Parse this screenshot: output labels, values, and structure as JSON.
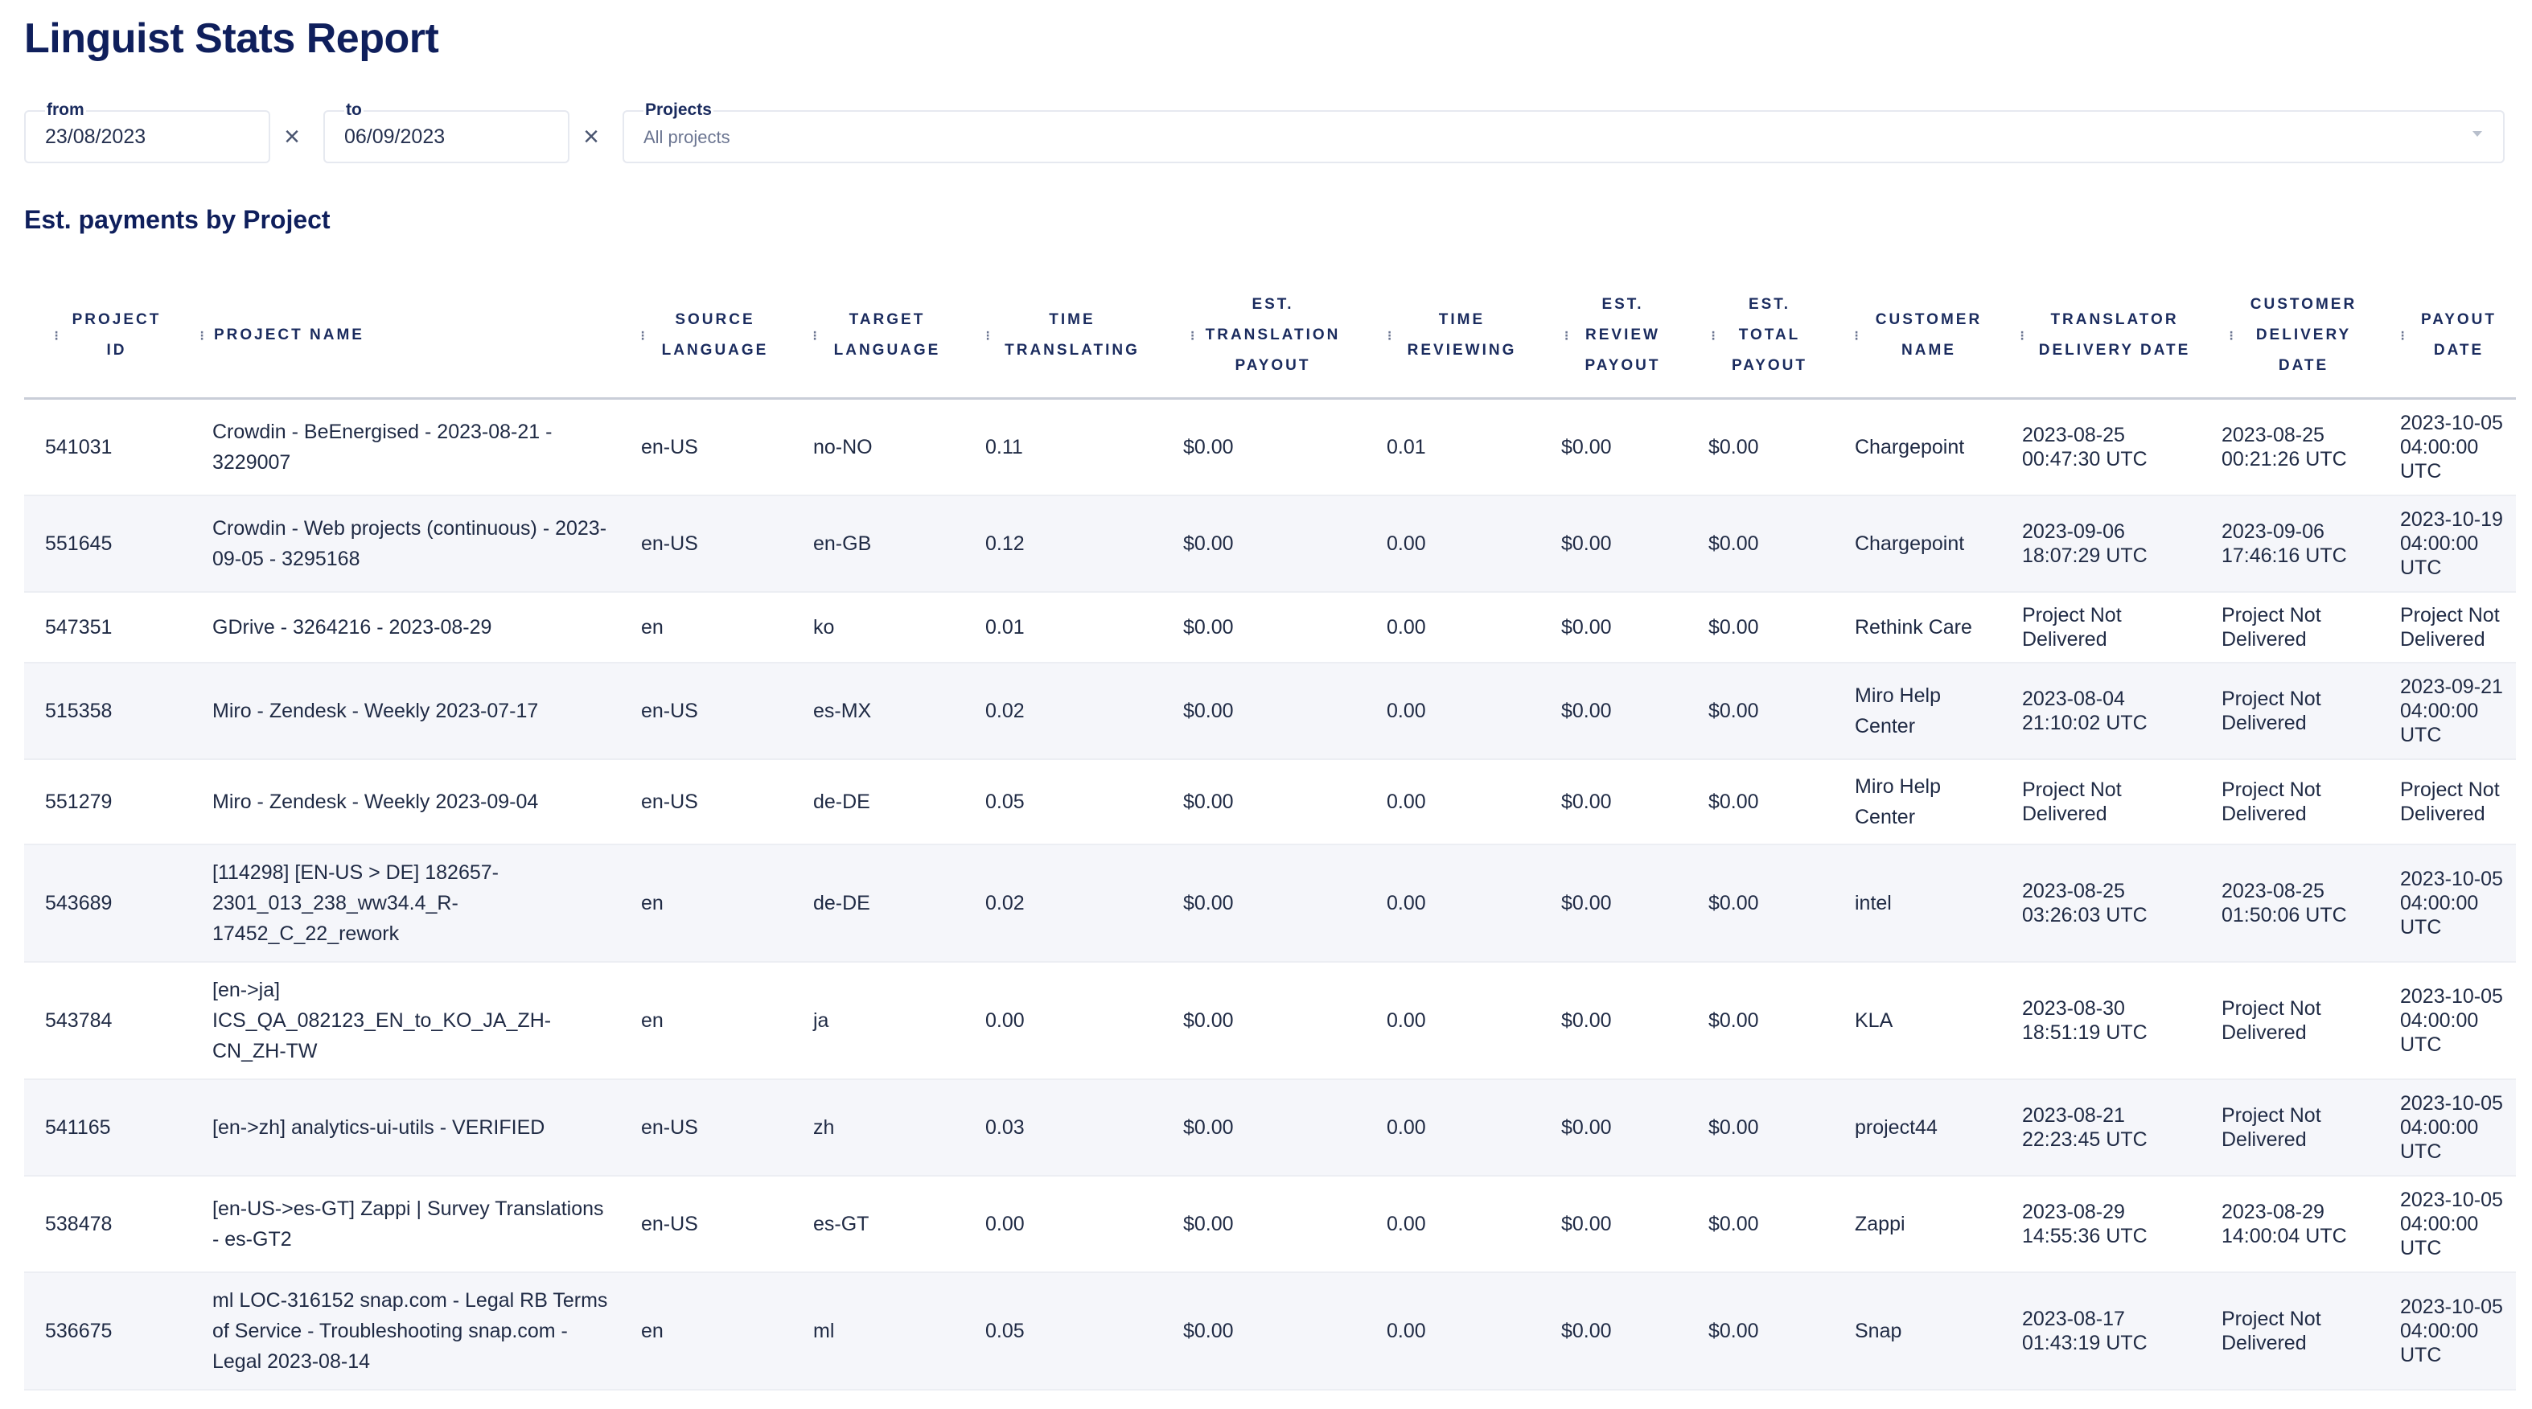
{
  "page": {
    "title": "Linguist Stats Report"
  },
  "filters": {
    "from": {
      "label": "from",
      "value": "23/08/2023"
    },
    "to": {
      "label": "to",
      "value": "06/09/2023"
    },
    "projects": {
      "label": "Projects",
      "placeholder": "All projects"
    }
  },
  "section": {
    "title": "Est. payments by Project"
  },
  "table": {
    "headers": [
      "Project ID",
      "Project Name",
      "Source Language",
      "Target Language",
      "Time Translating",
      "Est. Translation Payout",
      "Time Reviewing",
      "Est. Review Payout",
      "Est. Total Payout",
      "Customer Name",
      "Translator Delivery Date",
      "Customer Delivery Date",
      "Payout Date"
    ],
    "rows": [
      [
        "541031",
        "Crowdin - BeEnergised - 2023-08-21 - 3229007",
        "en-US",
        "no-NO",
        "0.11",
        "$0.00",
        "0.01",
        "$0.00",
        "$0.00",
        "Chargepoint",
        "2023-08-25 00:47:30 UTC",
        "2023-08-25 00:21:26 UTC",
        "2023-10-05 04:00:00 UTC"
      ],
      [
        "551645",
        "Crowdin - Web projects (continuous) - 2023-09-05 - 3295168",
        "en-US",
        "en-GB",
        "0.12",
        "$0.00",
        "0.00",
        "$0.00",
        "$0.00",
        "Chargepoint",
        "2023-09-06 18:07:29 UTC",
        "2023-09-06 17:46:16 UTC",
        "2023-10-19 04:00:00 UTC"
      ],
      [
        "547351",
        "GDrive - 3264216 - 2023-08-29",
        "en",
        "ko",
        "0.01",
        "$0.00",
        "0.00",
        "$0.00",
        "$0.00",
        "Rethink Care",
        "Project Not Delivered",
        "Project Not Delivered",
        "Project Not Delivered"
      ],
      [
        "515358",
        "Miro - Zendesk - Weekly 2023-07-17",
        "en-US",
        "es-MX",
        "0.02",
        "$0.00",
        "0.00",
        "$0.00",
        "$0.00",
        "Miro Help Center",
        "2023-08-04 21:10:02 UTC",
        "Project Not Delivered",
        "2023-09-21 04:00:00 UTC"
      ],
      [
        "551279",
        "Miro - Zendesk - Weekly 2023-09-04",
        "en-US",
        "de-DE",
        "0.05",
        "$0.00",
        "0.00",
        "$0.00",
        "$0.00",
        "Miro Help Center",
        "Project Not Delivered",
        "Project Not Delivered",
        "Project Not Delivered"
      ],
      [
        "543689",
        "[114298] [EN-US > DE] 182657-2301_013_238_ww34.4_R-17452_C_22_rework",
        "en",
        "de-DE",
        "0.02",
        "$0.00",
        "0.00",
        "$0.00",
        "$0.00",
        "intel",
        "2023-08-25 03:26:03 UTC",
        "2023-08-25 01:50:06 UTC",
        "2023-10-05 04:00:00 UTC"
      ],
      [
        "543784",
        "[en->ja] ICS_QA_082123_EN_to_KO_JA_ZH-CN_ZH-TW",
        "en",
        "ja",
        "0.00",
        "$0.00",
        "0.00",
        "$0.00",
        "$0.00",
        "KLA",
        "2023-08-30 18:51:19 UTC",
        "Project Not Delivered",
        "2023-10-05 04:00:00 UTC"
      ],
      [
        "541165",
        "[en->zh] analytics-ui-utils - VERIFIED",
        "en-US",
        "zh",
        "0.03",
        "$0.00",
        "0.00",
        "$0.00",
        "$0.00",
        "project44",
        "2023-08-21 22:23:45 UTC",
        "Project Not Delivered",
        "2023-10-05 04:00:00 UTC"
      ],
      [
        "538478",
        "[en-US->es-GT] Zappi | Survey Translations - es-GT2",
        "en-US",
        "es-GT",
        "0.00",
        "$0.00",
        "0.00",
        "$0.00",
        "$0.00",
        "Zappi",
        "2023-08-29 14:55:36 UTC",
        "2023-08-29 14:00:04 UTC",
        "2023-10-05 04:00:00 UTC"
      ],
      [
        "536675",
        "ml LOC-316152 snap.com - Legal RB Terms of Service - Troubleshooting snap.com - Legal 2023-08-14",
        "en",
        "ml",
        "0.05",
        "$0.00",
        "0.00",
        "$0.00",
        "$0.00",
        "Snap",
        "2023-08-17 01:43:19 UTC",
        "Project Not Delivered",
        "2023-10-05 04:00:00 UTC"
      ]
    ]
  }
}
